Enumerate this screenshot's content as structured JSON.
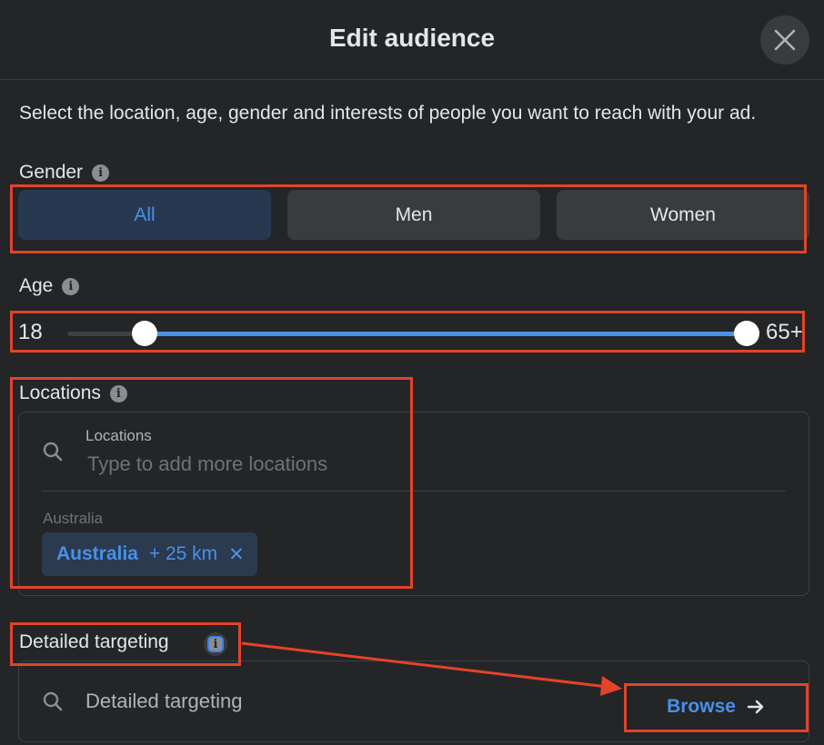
{
  "header": {
    "title": "Edit audience",
    "close_icon": "close-icon"
  },
  "intro": "Select the location, age, gender and interests of people you want to reach with your ad.",
  "gender": {
    "label": "Gender",
    "options": [
      {
        "label": "All",
        "selected": true
      },
      {
        "label": "Men",
        "selected": false
      },
      {
        "label": "Women",
        "selected": false
      }
    ]
  },
  "age": {
    "label": "Age",
    "min_label": "18",
    "max_label": "65+",
    "range_min": 18,
    "range_max": 65,
    "selected_min": 18,
    "selected_max": 65
  },
  "locations": {
    "label": "Locations",
    "field_label": "Locations",
    "placeholder": "Type to add more locations",
    "group_label": "Australia",
    "chips": [
      {
        "name": "Australia",
        "radius": "+ 25 km",
        "remove": "✕"
      }
    ]
  },
  "detailed_targeting": {
    "label": "Detailed targeting",
    "placeholder": "Detailed targeting",
    "browse_label": "Browse",
    "browse_arrow": "→"
  },
  "colors": {
    "accent": "#4a90e8",
    "background": "#242526",
    "annotation": "#e2432a"
  }
}
